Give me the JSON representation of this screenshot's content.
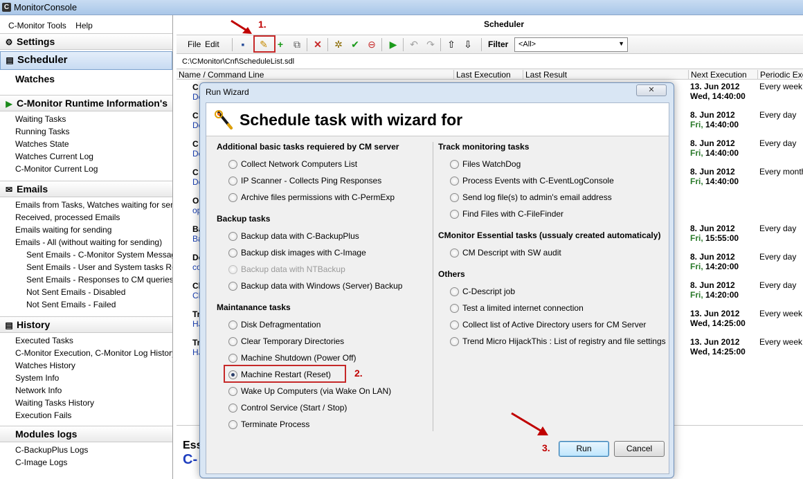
{
  "window": {
    "title": "MonitorConsole",
    "icon_letter": "C"
  },
  "left_panel": {
    "menu": [
      "C-Monitor Tools",
      "Help"
    ],
    "settings": "Settings",
    "scheduler": "Scheduler",
    "watches": "Watches",
    "runtime": {
      "header": "C-Monitor Runtime Information's",
      "items": [
        "Waiting Tasks",
        "Running Tasks",
        "Watches State",
        "Watches Current Log",
        "C-Monitor Current Log"
      ]
    },
    "emails": {
      "header": "Emails",
      "items": [
        "Emails from Tasks, Watches waiting for sending",
        "Received, processed Emails",
        "Emails waiting for sending",
        "Emails - All (without waiting for sending)"
      ],
      "subitems": [
        "Sent Emails - C-Monitor System Messages",
        "Sent Emails - User and System tasks Results",
        "Sent Emails - Responses to CM queries",
        "Not Sent Emails - Disabled",
        "Not Sent Emails - Failed"
      ]
    },
    "history": {
      "header": "History",
      "items": [
        "Executed Tasks",
        "C-Monitor Execution, C-Monitor Log History",
        "Watches History",
        "System Info",
        "Network Info",
        "Waiting Tasks History",
        "Execution Fails"
      ]
    },
    "modules": {
      "header": "Modules logs",
      "items": [
        "C-BackupPlus Logs",
        "C-Image Logs"
      ]
    }
  },
  "scheduler": {
    "title": "Scheduler",
    "menu": [
      "File",
      "Edit"
    ],
    "filter_label": "Filter",
    "filter_value": "<All>",
    "path": "C:\\CMonitor\\Cnf\\ScheduleList.sdl",
    "columns": [
      "Name / Command Line",
      "Last Execution",
      "Last Result",
      "Next Execution",
      "Periodic Exec"
    ],
    "rows": [
      {
        "a": "C",
        "b": "De",
        "date": "13. Jun 2012",
        "day": "Wed,",
        "time": "14:40:00",
        "periodic": "Every week i"
      },
      {
        "a": "C",
        "b": "De",
        "date": "8. Jun 2012",
        "day": "Fri,",
        "time": "14:40:00",
        "periodic": "Every day"
      },
      {
        "a": "C",
        "b": "De",
        "date": "8. Jun 2012",
        "day": "Fri,",
        "time": "14:40:00",
        "periodic": "Every day"
      },
      {
        "a": "C",
        "b": "De",
        "date": "8. Jun 2012",
        "day": "Fri,",
        "time": "14:40:00",
        "periodic": "Every month"
      },
      {
        "a": "Or",
        "b": "op",
        "date": "",
        "day": "",
        "time": "",
        "periodic": ""
      },
      {
        "a": "Ba",
        "b": "Ba",
        "date": "8. Jun 2012",
        "day": "Fri,",
        "time": "15:55:00",
        "periodic": "Every day"
      },
      {
        "a": "De",
        "b": "co",
        "date": "8. Jun 2012",
        "day": "Fri,",
        "time": "14:20:00",
        "periodic": "Every day"
      },
      {
        "a": "Cl",
        "b": "CL",
        "date": "8. Jun 2012",
        "day": "Fri,",
        "time": "14:20:00",
        "periodic": "Every day"
      },
      {
        "a": "Tr",
        "b": "HJ",
        "date": "13. Jun 2012",
        "day": "Wed,",
        "time": "14:25:00",
        "periodic": "Every week i"
      },
      {
        "a": "Tr",
        "b": "HJ",
        "date": "13. Jun 2012",
        "day": "Wed,",
        "time": "14:25:00",
        "periodic": "Every week i"
      }
    ],
    "bottom_line1": "Ess",
    "bottom_line2": "C-"
  },
  "dialog": {
    "title": "Run Wizard",
    "close_label": "✕",
    "heading": "Schedule task with wizard for",
    "groups": {
      "basic": {
        "title": "Additional basic tasks requiered by CM server",
        "options": [
          "Collect Network Computers List",
          "IP Scanner - Collects Ping Responses",
          "Archive files permissions with C-PermExp"
        ]
      },
      "backup": {
        "title": "Backup tasks",
        "options": [
          "Backup data with C-BackupPlus",
          "Backup disk images with C-Image",
          "Backup data with NTBackup",
          "Backup data with Windows (Server) Backup"
        ]
      },
      "maint": {
        "title": "Maintanance tasks",
        "options": [
          "Disk Defragmentation",
          "Clear Temporary Directories",
          "Machine Shutdown (Power Off)",
          "Machine Restart (Reset)",
          "Wake Up Computers (via Wake On LAN)",
          "Control Service (Start / Stop)",
          "Terminate Process"
        ]
      },
      "track": {
        "title": "Track monitoring tasks",
        "options": [
          "Files WatchDog",
          "Process Events with C-EventLogConsole",
          "Send log file(s) to admin's email address",
          "Find Files with C-FileFinder"
        ]
      },
      "essential": {
        "title": "CMonitor Essential tasks (ussualy created automaticaly)",
        "options": [
          "CM Descript with SW audit"
        ]
      },
      "others": {
        "title": "Others",
        "options": [
          "C-Descript job",
          "Test a limited internet connection",
          "Collect list of Active Directory users for CM Server",
          "Trend Micro HijackThis : List of registry and file settings"
        ]
      }
    },
    "run_label": "Run",
    "cancel_label": "Cancel"
  },
  "annotations": {
    "step1": "1.",
    "step2": "2.",
    "step3": "3."
  },
  "colors": {
    "accent_red": "#c00000",
    "link_blue": "#1a3fb0",
    "day_green": "#2a7a2a"
  }
}
